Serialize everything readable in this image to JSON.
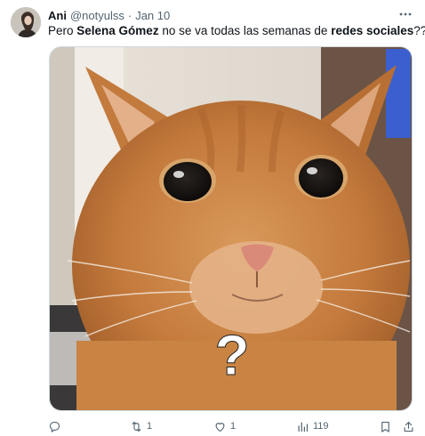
{
  "tweet": {
    "author_name": "Ani",
    "handle": "@notyulss",
    "separator": "·",
    "date": "Jan 10",
    "text_parts": {
      "p1": "Pero ",
      "b1": "Selena Gómez",
      "p2": " no se va todas las semanas de ",
      "b2": "redes sociales",
      "p3": "??"
    },
    "media_overlay_text": "?",
    "actions": {
      "reply_count": "",
      "retweet_count": "1",
      "like_count": "1",
      "views_count": "119"
    }
  },
  "icons": {
    "more": "more-dots-icon",
    "reply": "reply-icon",
    "retweet": "retweet-icon",
    "like": "heart-icon",
    "views": "views-chart-icon",
    "bookmark": "bookmark-icon",
    "share": "share-icon"
  },
  "colors": {
    "text_primary": "#0f1419",
    "text_secondary": "#536471",
    "border": "#cfd9de"
  }
}
